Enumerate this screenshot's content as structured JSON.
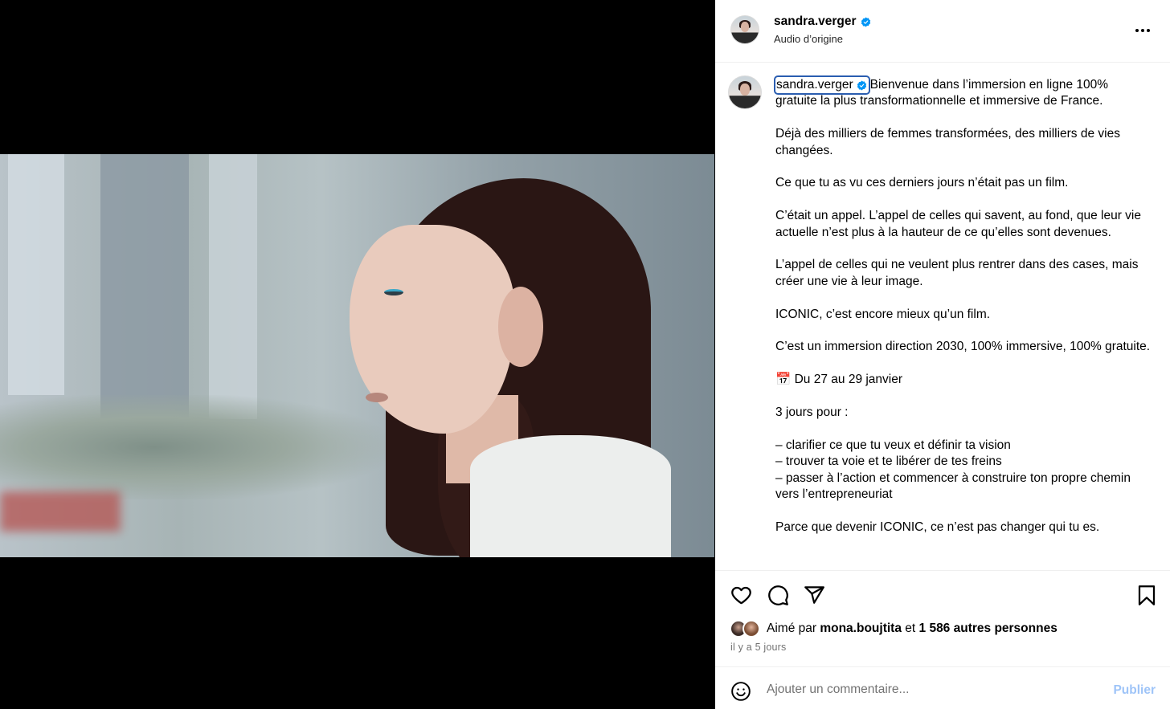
{
  "post": {
    "username": "sandra.verger",
    "audio_label": "Audio d’origine",
    "verified_color": "#0095f6",
    "icons": {
      "more": "more-options-icon",
      "mute": "muted-speaker-icon",
      "verified": "verified-badge-icon"
    }
  },
  "caption": {
    "username": "sandra.verger",
    "intro": "Bienvenue dans l’immersion en ligne 100% gratuite la plus transformationnelle et immersive de France.",
    "paragraphs": [
      "Déjà des milliers de femmes transformées, des milliers de vies changées.",
      "Ce que tu as vu ces derniers jours n’était pas un film.",
      "C’était un appel. L’appel de celles qui savent, au fond, que leur vie actuelle n’est plus à la hauteur de ce qu’elles sont devenues.",
      "L’appel de celles qui ne veulent plus rentrer dans des cases, mais créer une vie à leur image.",
      "ICONIC, c’est encore mieux qu’un film.",
      "C’est un immersion direction 2030, 100% immersive, 100% gratuite.",
      "📅 Du 27 au 29 janvier",
      "3 jours pour :"
    ],
    "list": [
      "– clarifier ce que tu veux et définir ta vision",
      "– trouver ta voie et te libérer de tes freins",
      "– passer à l’action et commencer à construire ton propre chemin vers l’entrepreneuriat"
    ],
    "closing": "Parce que devenir ICONIC, ce n’est pas changer qui tu es."
  },
  "actions": {
    "icons": [
      "heart-icon",
      "comment-icon",
      "share-icon",
      "bookmark-icon"
    ]
  },
  "likes": {
    "prefix": "Aimé par",
    "user": "mona.boujtita",
    "connector": "et",
    "others": "1 586 autres personnes"
  },
  "timestamp": "il y a 5 jours",
  "comment": {
    "placeholder": "Ajouter un commentaire...",
    "publish_label": "Publier",
    "publish_color": "#9ec4f8"
  }
}
